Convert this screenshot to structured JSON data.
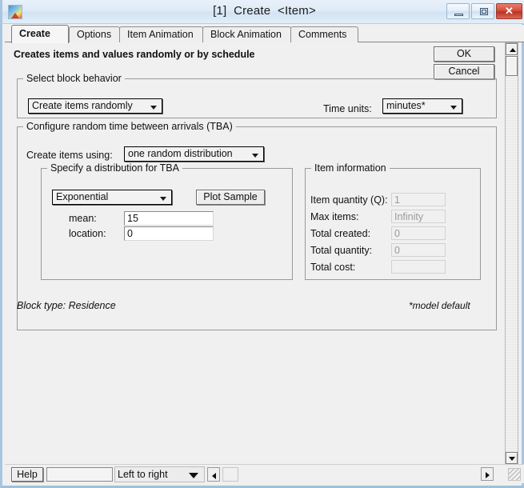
{
  "window": {
    "title": "[1]  Create  <Item>",
    "icon": "extendsim-logo-icon",
    "buttons": {
      "minimize": "minimize-icon",
      "maximize": "maximize-icon",
      "close": "✕"
    }
  },
  "tabs": [
    {
      "label": "Create",
      "active": true
    },
    {
      "label": "Options",
      "active": false
    },
    {
      "label": "Item Animation",
      "active": false
    },
    {
      "label": "Block Animation",
      "active": false
    },
    {
      "label": "Comments",
      "active": false
    }
  ],
  "main": {
    "headline": "Creates items and values randomly or by schedule",
    "ok_label": "OK",
    "cancel_label": "Cancel",
    "block_behavior": {
      "legend": "Select block behavior",
      "behavior_value": "Create items randomly",
      "time_units_label": "Time units:",
      "time_units_value": "minutes*"
    },
    "tba": {
      "legend": "Configure random time between arrivals (TBA)",
      "create_using_label": "Create items using:",
      "create_using_value": "one random distribution",
      "distribution": {
        "legend": "Specify a distribution for TBA",
        "dist_value": "Exponential",
        "plot_sample_label": "Plot Sample",
        "mean_label": "mean:",
        "mean_value": "15",
        "location_label": "location:",
        "location_value": "0"
      },
      "item_information": {
        "legend": "Item information",
        "rows": [
          {
            "label": "Item quantity (Q):",
            "value": "1"
          },
          {
            "label": "Max items:",
            "value": "Infinity"
          },
          {
            "label": "Total created:",
            "value": "0"
          },
          {
            "label": "Total quantity:",
            "value": "0"
          },
          {
            "label": "Total cost:",
            "value": ""
          }
        ]
      }
    },
    "footer_left": "Block type:  Residence",
    "footer_right": "*model default"
  },
  "statusbar": {
    "help_label": "Help",
    "status_value": "",
    "flow_direction": "Left to right"
  },
  "colors": {
    "window_bg": "#f0f0f0",
    "frame_border": "#a8c6df",
    "title_text": "#1b1b1b",
    "close_button": "#c0392b",
    "readonly_text": "#9a9a9a"
  }
}
